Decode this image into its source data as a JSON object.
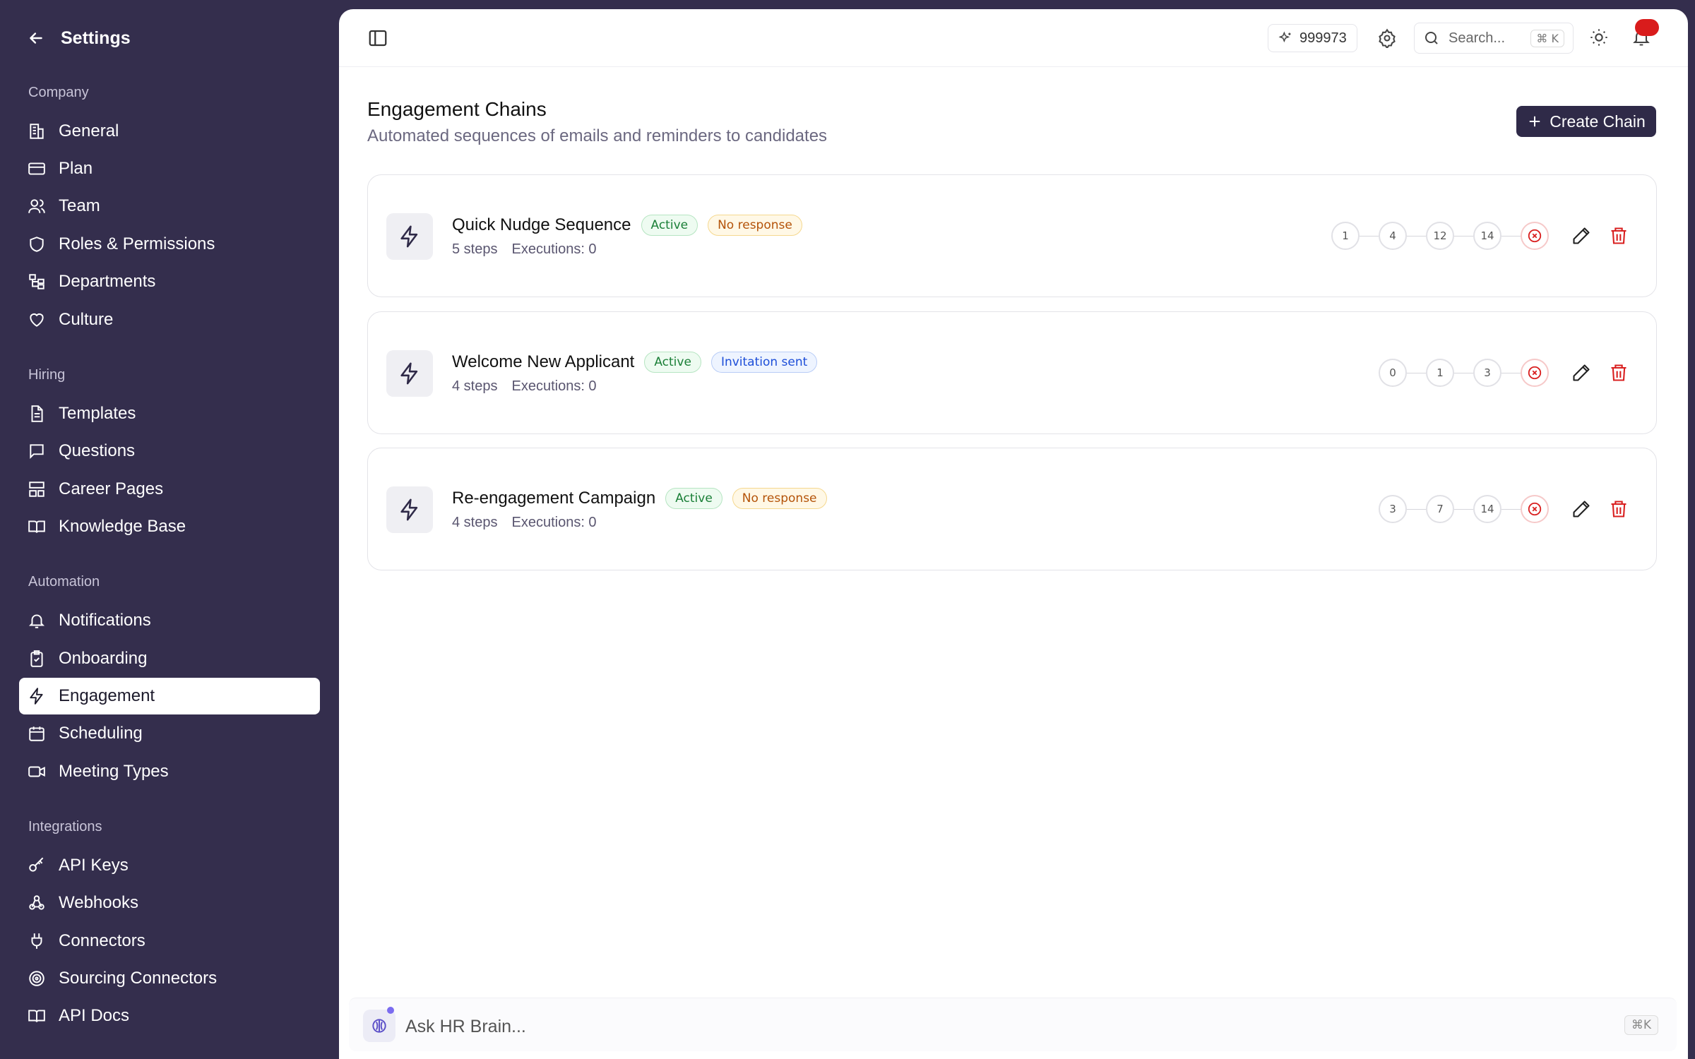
{
  "sidebar": {
    "title": "Settings",
    "sections": {
      "company": "Company",
      "hiring": "Hiring",
      "automation": "Automation",
      "integrations": "Integrations"
    },
    "items": {
      "general": "General",
      "plan": "Plan",
      "team": "Team",
      "roles": "Roles & Permissions",
      "departments": "Departments",
      "culture": "Culture",
      "templates": "Templates",
      "questions": "Questions",
      "career_pages": "Career Pages",
      "knowledge_base": "Knowledge Base",
      "notifications": "Notifications",
      "onboarding": "Onboarding",
      "engagement": "Engagement",
      "scheduling": "Scheduling",
      "meeting_types": "Meeting Types",
      "api_keys": "API Keys",
      "webhooks": "Webhooks",
      "connectors": "Connectors",
      "sourcing_connectors": "Sourcing Connectors",
      "api_docs": "API Docs"
    },
    "active_item": "engagement"
  },
  "topbar": {
    "credits": "999973",
    "search_placeholder": "Search...",
    "search_shortcut": "⌘ K"
  },
  "page": {
    "title": "Engagement Chains",
    "subtitle": "Automated sequences of emails and reminders to candidates",
    "create_label": "Create Chain"
  },
  "chains": [
    {
      "name": "Quick Nudge Sequence",
      "status": "Active",
      "trigger": "No response",
      "steps_label": "5 steps",
      "executions_label": "Executions: 0",
      "days": [
        "1",
        "4",
        "12",
        "14"
      ]
    },
    {
      "name": "Welcome New Applicant",
      "status": "Active",
      "trigger": "Invitation sent",
      "steps_label": "4 steps",
      "executions_label": "Executions: 0",
      "days": [
        "0",
        "1",
        "3"
      ]
    },
    {
      "name": "Re-engagement Campaign",
      "status": "Active",
      "trigger": "No response",
      "steps_label": "4 steps",
      "executions_label": "Executions: 0",
      "days": [
        "3",
        "7",
        "14"
      ]
    }
  ],
  "assistant": {
    "placeholder": "Ask HR Brain...",
    "shortcut": "⌘K"
  },
  "colors": {
    "sidebar_bg": "#342e4d",
    "primary": "#2f2a48",
    "danger": "#d92020",
    "active_green": "#1a7f37",
    "warning_amber": "#b45309",
    "info_blue": "#1d4ed8"
  }
}
